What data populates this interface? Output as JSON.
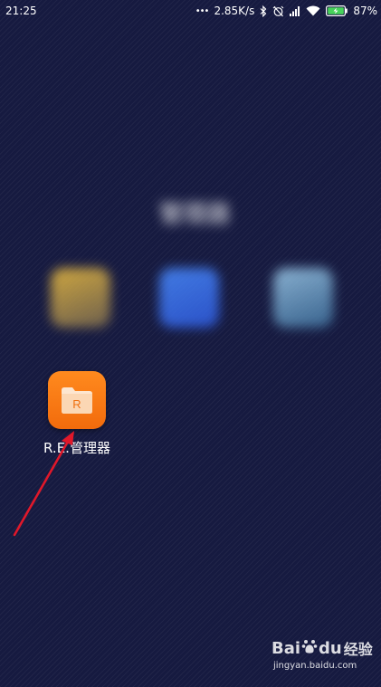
{
  "status_bar": {
    "time": "21:25",
    "dots": "•••",
    "network_speed": "2.85K/s",
    "battery_percent": "87%",
    "icons": [
      "bluetooth-icon",
      "alarm-off-icon",
      "signal-icon",
      "wifi-icon",
      "battery-charging-icon"
    ]
  },
  "folder": {
    "title": "管理器",
    "apps": [
      {
        "icon": "folder-app-icon-1"
      },
      {
        "icon": "folder-app-icon-2"
      },
      {
        "icon": "folder-app-icon-3"
      }
    ]
  },
  "home_app": {
    "label": "R.E.管理器",
    "icon_letter": "R",
    "icon": "re-manager-icon",
    "accent_color": "#f7780f"
  },
  "annotation": {
    "arrow_color": "#e0182a"
  },
  "watermark": {
    "brand_prefix": "Bai",
    "brand_suffix": "du",
    "brand_sub": "经验",
    "url": "jingyan.baidu.com"
  }
}
